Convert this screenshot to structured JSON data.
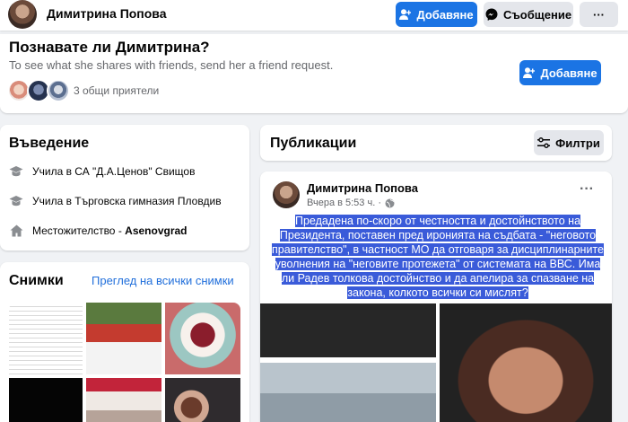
{
  "header": {
    "name": "Димитрина Попова",
    "add_friend_label": "Добавяне",
    "message_label": "Съобщение",
    "more_label": "···"
  },
  "friend_request": {
    "title": "Познавате ли Димитрина?",
    "subtitle": "To see what she shares with friends, send her a friend request.",
    "mutual_friends": "3 общи приятели",
    "add_label": "Добавяне"
  },
  "intro": {
    "title": "Въведение",
    "items": [
      {
        "icon": "graduation-cap-icon",
        "text": "Учила в СА \"Д.А.Ценов\" Свищов",
        "bold": ""
      },
      {
        "icon": "graduation-cap-icon",
        "text": "Учила в Търговска гимназия Пловдив",
        "bold": ""
      },
      {
        "icon": "home-icon",
        "text": "Местожителство - ",
        "bold": "Asenovgrad"
      }
    ]
  },
  "photos": {
    "title": "Снимки",
    "see_all": "Преглед на всички снимки"
  },
  "publications": {
    "title": "Публикации",
    "filter_label": "Филтри"
  },
  "post": {
    "author": "Димитрина Попова",
    "time": "Вчера в 5:53 ч. ·",
    "text": "Предадена по-скоро от честността и достойнството на Президента, поставен пред иронията на съдбата - \"неговото правителство\", в частност МО да отговаря за дисциплинарните уволнения на \"неговите протежета\" от системата на ВВС. Има ли Радев толкова достойнство и да апелира за спазване на закона, колкото всички си мислят?"
  },
  "colors": {
    "primary": "#1b74e4",
    "link": "#216fdb",
    "selection": "#3a5bd9",
    "background": "#f0f2f5"
  }
}
